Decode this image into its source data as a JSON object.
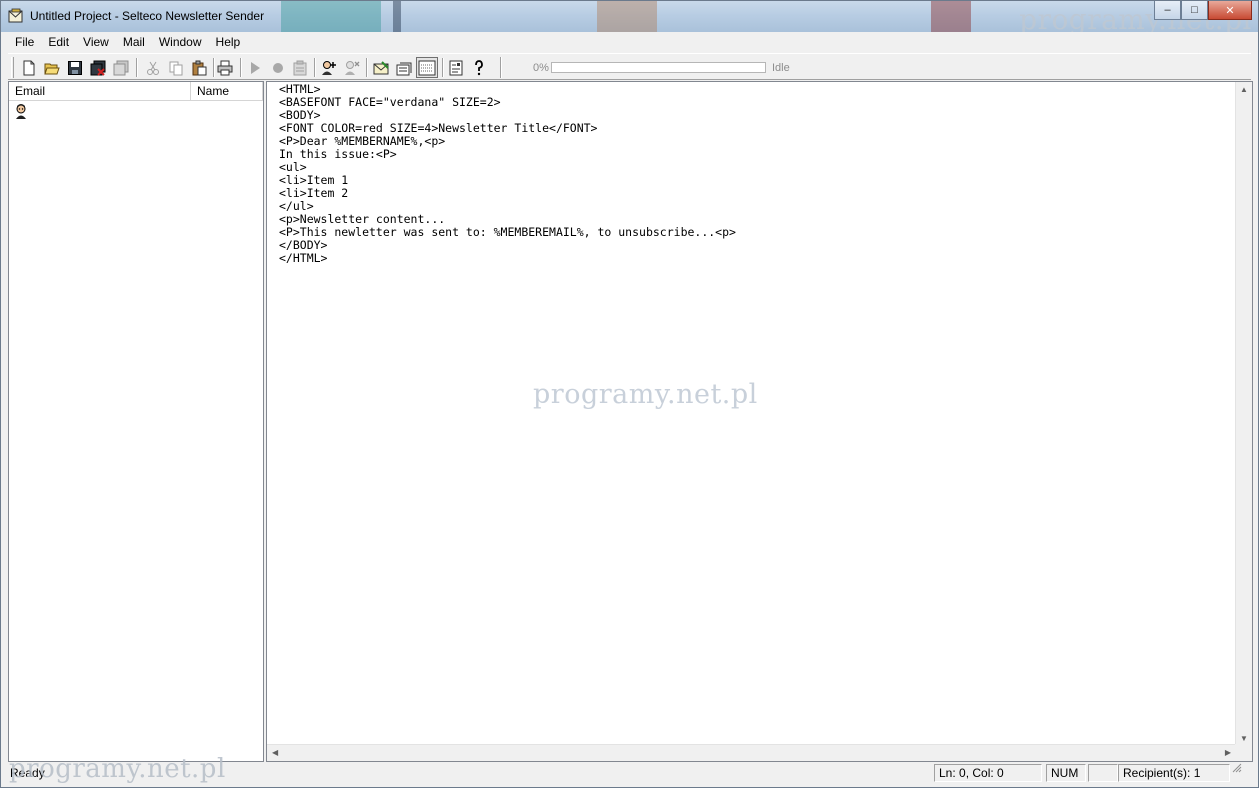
{
  "window": {
    "title": "Untitled Project  - Selteco Newsletter Sender",
    "controls": {
      "minimize": "–",
      "maximize": "□",
      "close": "✕"
    }
  },
  "watermark": "programy.net.pl",
  "menu": [
    "File",
    "Edit",
    "View",
    "Mail",
    "Window",
    "Help"
  ],
  "toolbar": {
    "buttons": [
      {
        "name": "new-icon"
      },
      {
        "name": "open-icon"
      },
      {
        "name": "save-icon"
      },
      {
        "name": "save-all-icon"
      },
      {
        "name": "properties-icon"
      },
      {
        "name": "cut-icon"
      },
      {
        "name": "copy-icon"
      },
      {
        "name": "paste-icon"
      },
      {
        "name": "print-icon"
      },
      {
        "name": "play-icon"
      },
      {
        "name": "record-icon"
      },
      {
        "name": "clipboard-icon"
      },
      {
        "name": "add-recipient-icon"
      },
      {
        "name": "remove-recipient-icon"
      },
      {
        "name": "mail-settings-icon"
      },
      {
        "name": "mail-send-icon"
      },
      {
        "name": "html-code-icon"
      },
      {
        "name": "options-icon"
      },
      {
        "name": "help-icon"
      }
    ],
    "progress": {
      "percent_label": "0%",
      "value": 0,
      "status": "Idle",
      "fill_color": "#3c9c3c"
    }
  },
  "recipients": {
    "columns": [
      "Email",
      "Name"
    ],
    "rows": [
      {
        "icon": "person-icon",
        "email": "",
        "name": ""
      }
    ]
  },
  "editor": {
    "lines": [
      "<HTML>",
      "<BASEFONT FACE=\"verdana\" SIZE=2>",
      "<BODY>",
      "<FONT COLOR=red SIZE=4>Newsletter Title</FONT>",
      "<P>Dear %MEMBERNAME%,<p>",
      "In this issue:<P>",
      "<ul>",
      "<li>Item 1",
      "<li>Item 2",
      "</ul>",
      "<p>Newsletter content...",
      "<P>This newletter was sent to: %MEMBEREMAIL%, to unsubscribe...<p>",
      "</BODY>",
      "</HTML>"
    ]
  },
  "statusbar": {
    "status": "Ready",
    "position": "Ln: 0, Col: 0",
    "num": "NUM",
    "recipients": "Recipient(s): 1"
  }
}
